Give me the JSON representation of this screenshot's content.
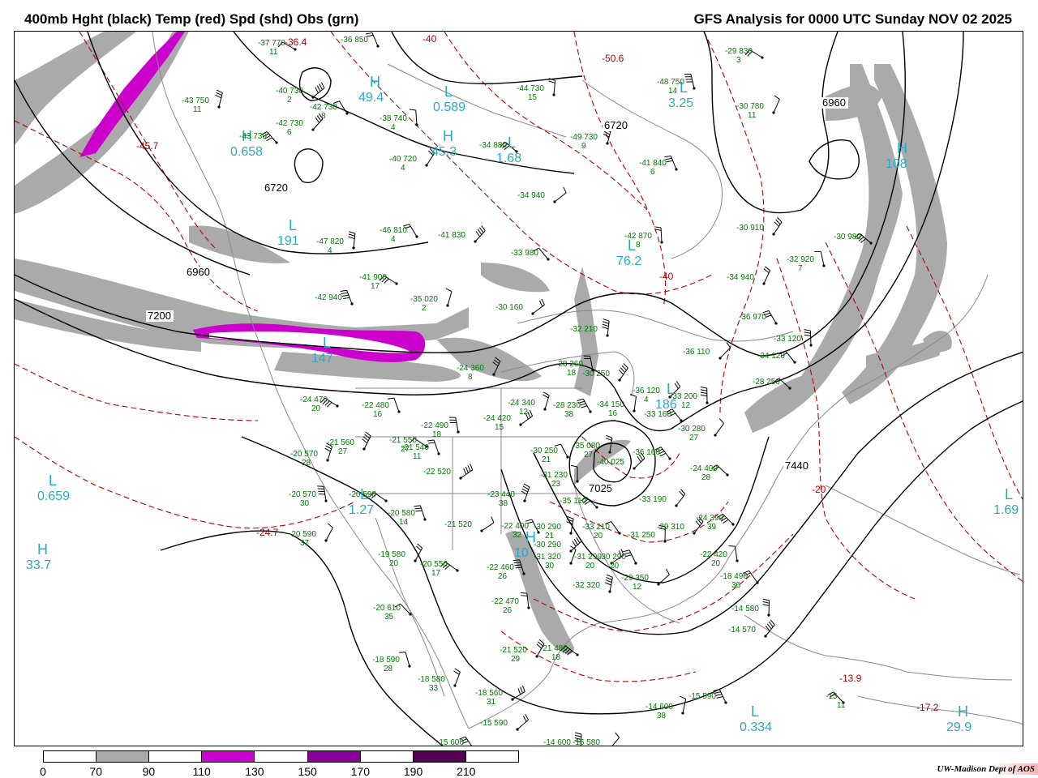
{
  "title_left": "400mb Hght (black) Temp (red) Spd (shd) Obs (grn)",
  "title_right": "GFS Analysis for 0000 UTC Sunday  NOV 02 2025",
  "credit": "UW-Madison  Dept of AOS",
  "colors": {
    "height_contour": "#000000",
    "temp_contour": "#b40000",
    "obs_text": "#007a00",
    "hl_label": "#29a9c4",
    "speed_70_90": "#aaaaaa",
    "speed_110_130": "#cc00cc",
    "speed_150_170": "#880099",
    "speed_190_210": "#550055",
    "coastline": "#888888"
  },
  "colorbar": {
    "ticks": [
      "0",
      "70",
      "90",
      "110",
      "130",
      "150",
      "170",
      "190",
      "210"
    ],
    "segments": [
      {
        "from": 0,
        "to": 70,
        "color": "#ffffff"
      },
      {
        "from": 70,
        "to": 90,
        "color": "#aaaaaa"
      },
      {
        "from": 90,
        "to": 110,
        "color": "#ffffff"
      },
      {
        "from": 110,
        "to": 130,
        "color": "#cc00cc"
      },
      {
        "from": 130,
        "to": 150,
        "color": "#ffffff"
      },
      {
        "from": 150,
        "to": 170,
        "color": "#880099"
      },
      {
        "from": 170,
        "to": 190,
        "color": "#ffffff"
      },
      {
        "from": 190,
        "to": 210,
        "color": "#550055"
      },
      {
        "from": 210,
        "to": 230,
        "color": "#ffffff"
      }
    ]
  },
  "contour_labels": [
    "6720",
    "6720",
    "6960",
    "6960",
    "7200",
    "7440",
    "7025"
  ],
  "temp_labels": [
    "-40",
    "-40",
    "-20",
    "-24.7",
    "-45.7",
    "-50.6",
    "-13.9",
    "-17.2",
    "-36.4"
  ],
  "highs_lows": [
    {
      "letter": "H",
      "value": "49.4"
    },
    {
      "letter": "L",
      "value": "0.589"
    },
    {
      "letter": "H",
      "value": "45.3"
    },
    {
      "letter": "L",
      "value": "1.68"
    },
    {
      "letter": "L",
      "value": "191"
    },
    {
      "letter": "H",
      "value": "0.658"
    },
    {
      "letter": "L",
      "value": "3.25"
    },
    {
      "letter": "H",
      "value": "108"
    },
    {
      "letter": "L",
      "value": "76.2"
    },
    {
      "letter": "L",
      "value": "0.659"
    },
    {
      "letter": "H",
      "value": "33.7"
    },
    {
      "letter": "L",
      "value": "1.27"
    },
    {
      "letter": "L",
      "value": "1.69"
    },
    {
      "letter": "L",
      "value": "0.334"
    },
    {
      "letter": "H",
      "value": "29.9"
    },
    {
      "letter": "L",
      "value": "186"
    },
    {
      "letter": "L",
      "value": "147"
    },
    {
      "letter": "H",
      "value": "10"
    }
  ],
  "observations": [
    {
      "t": "-37",
      "h": "770",
      "d": "11"
    },
    {
      "t": "-36",
      "h": "850",
      "d": ""
    },
    {
      "t": "-43",
      "h": "750",
      "d": "11"
    },
    {
      "t": "-40",
      "h": "730",
      "d": "2"
    },
    {
      "t": "-42",
      "h": "730",
      "d": "8"
    },
    {
      "t": "-44",
      "h": "730",
      "d": "15"
    },
    {
      "t": "-42",
      "h": "730",
      "d": "6"
    },
    {
      "t": "-43",
      "h": "730",
      "d": ""
    },
    {
      "t": "-38",
      "h": "740",
      "d": "4"
    },
    {
      "t": "-40",
      "h": "720",
      "d": "4"
    },
    {
      "t": "-34",
      "h": "880",
      "d": ""
    },
    {
      "t": "-48",
      "h": "750",
      "d": "14"
    },
    {
      "t": "-30",
      "h": "780",
      "d": "11"
    },
    {
      "t": "-29",
      "h": "830",
      "d": "3"
    },
    {
      "t": "-41",
      "h": "840",
      "d": "6"
    },
    {
      "t": "-49",
      "h": "730",
      "d": "9"
    },
    {
      "t": "-34",
      "h": "940",
      "d": ""
    },
    {
      "t": "-46",
      "h": "810",
      "d": "4"
    },
    {
      "t": "-47",
      "h": "820",
      "d": "4"
    },
    {
      "t": "-41",
      "h": "830",
      "d": ""
    },
    {
      "t": "-33",
      "h": "980",
      "d": ""
    },
    {
      "t": "-42",
      "h": "870",
      "d": "8"
    },
    {
      "t": "-30",
      "h": "910",
      "d": ""
    },
    {
      "t": "-30",
      "h": "980",
      "d": ""
    },
    {
      "t": "-32",
      "h": "920",
      "d": "7"
    },
    {
      "t": "-34",
      "h": "940",
      "d": ""
    },
    {
      "t": "-41",
      "h": "900",
      "d": "17"
    },
    {
      "t": "-42",
      "h": "940",
      "d": ""
    },
    {
      "t": "-35",
      "h": "020",
      "d": "2"
    },
    {
      "t": "-30",
      "h": "160",
      "d": ""
    },
    {
      "t": "-36",
      "h": "970",
      "d": ""
    },
    {
      "t": "-32",
      "h": "210",
      "d": ""
    },
    {
      "t": "-36",
      "h": "110",
      "d": ""
    },
    {
      "t": "-34",
      "h": "120",
      "d": ""
    },
    {
      "t": "-33",
      "h": "120",
      "d": ""
    },
    {
      "t": "-30",
      "h": "250",
      "d": ""
    },
    {
      "t": "-28",
      "h": "250",
      "d": ""
    },
    {
      "t": "-28",
      "h": "260",
      "d": "18"
    },
    {
      "t": "-24",
      "h": "360",
      "d": "8"
    },
    {
      "t": "-24",
      "h": "470",
      "d": "20"
    },
    {
      "t": "-22",
      "h": "480",
      "d": "16"
    },
    {
      "t": "-24",
      "h": "340",
      "d": "12"
    },
    {
      "t": "-24",
      "h": "420",
      "d": "15"
    },
    {
      "t": "-28",
      "h": "230",
      "d": "38"
    },
    {
      "t": "-34",
      "h": "150",
      "d": "16"
    },
    {
      "t": "-36",
      "h": "120",
      "d": "4"
    },
    {
      "t": "-33",
      "h": "160",
      "d": ""
    },
    {
      "t": "-33",
      "h": "200",
      "d": "12"
    },
    {
      "t": "-30",
      "h": "280",
      "d": "27"
    },
    {
      "t": "-24",
      "h": "400",
      "d": "28"
    },
    {
      "t": "-22",
      "h": "490",
      "d": "18"
    },
    {
      "t": "-21",
      "h": "560",
      "d": "27"
    },
    {
      "t": "-21",
      "h": "550",
      "d": "27"
    },
    {
      "t": "-21",
      "h": "540",
      "d": "11"
    },
    {
      "t": "-20",
      "h": "570",
      "d": "28"
    },
    {
      "t": "-22",
      "h": "520",
      "d": ""
    },
    {
      "t": "-30",
      "h": "250",
      "d": "21"
    },
    {
      "t": "-35",
      "h": "080",
      "d": "27"
    },
    {
      "t": "-40",
      "h": "025",
      "d": ""
    },
    {
      "t": "-36",
      "h": "160",
      "d": ""
    },
    {
      "t": "-31",
      "h": "230",
      "d": "23"
    },
    {
      "t": "-33",
      "h": "190",
      "d": ""
    },
    {
      "t": "-35",
      "h": "110",
      "d": ""
    },
    {
      "t": "-20",
      "h": "570",
      "d": "30"
    },
    {
      "t": "-20",
      "h": "590",
      "d": "37"
    },
    {
      "t": "-20",
      "h": "590",
      "d": ""
    },
    {
      "t": "-20",
      "h": "580",
      "d": "14"
    },
    {
      "t": "-23",
      "h": "440",
      "d": "38"
    },
    {
      "t": "-21",
      "h": "520",
      "d": ""
    },
    {
      "t": "-22",
      "h": "400",
      "d": "32"
    },
    {
      "t": "-30",
      "h": "290",
      "d": "21"
    },
    {
      "t": "-30",
      "h": "290",
      "d": ""
    },
    {
      "t": "-33",
      "h": "210",
      "d": "20"
    },
    {
      "t": "-31",
      "h": "250",
      "d": ""
    },
    {
      "t": "-29",
      "h": "310",
      "d": ""
    },
    {
      "t": "-24",
      "h": "390",
      "d": "39"
    },
    {
      "t": "-22",
      "h": "420",
      "d": "20"
    },
    {
      "t": "-19",
      "h": "580",
      "d": "20"
    },
    {
      "t": "-20",
      "h": "550",
      "d": "17"
    },
    {
      "t": "-22",
      "h": "460",
      "d": "26"
    },
    {
      "t": "-31",
      "h": "320",
      "d": "30"
    },
    {
      "t": "-31",
      "h": "290",
      "d": "20"
    },
    {
      "t": "-30",
      "h": "290",
      "d": "20"
    },
    {
      "t": "-32",
      "h": "320",
      "d": ""
    },
    {
      "t": "-29",
      "h": "350",
      "d": "12"
    },
    {
      "t": "-18",
      "h": "490",
      "d": "36"
    },
    {
      "t": "-14",
      "h": "580",
      "d": ""
    },
    {
      "t": "-14",
      "h": "570",
      "d": ""
    },
    {
      "t": "-20",
      "h": "610",
      "d": "35"
    },
    {
      "t": "-22",
      "h": "470",
      "d": "26"
    },
    {
      "t": "-21",
      "h": "520",
      "d": "29"
    },
    {
      "t": "-21",
      "h": "480",
      "d": "18"
    },
    {
      "t": "-18",
      "h": "590",
      "d": "28"
    },
    {
      "t": "-18",
      "h": "580",
      "d": "33"
    },
    {
      "t": "-18",
      "h": "560",
      "d": "31"
    },
    {
      "t": "-15",
      "h": "590",
      "d": ""
    },
    {
      "t": "-14",
      "h": "600",
      "d": "38"
    },
    {
      "t": "-15",
      "h": "590",
      "d": ""
    },
    {
      "t": "-15",
      "h": "600",
      "d": ""
    },
    {
      "t": "-14",
      "h": "600",
      "d": ""
    },
    {
      "t": "-15",
      "h": "580",
      "d": ""
    },
    {
      "t": "-15",
      "h": "",
      "d": "11"
    }
  ]
}
